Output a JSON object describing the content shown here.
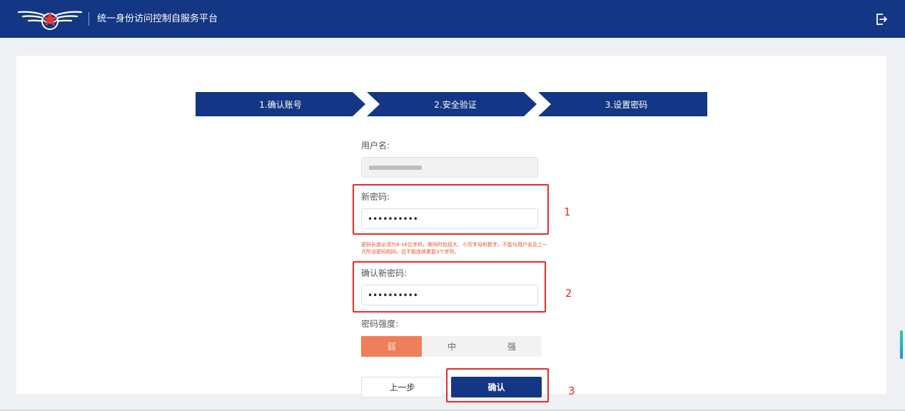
{
  "header": {
    "title": "统一身份访问控制自服务平台",
    "logo_icon": "wings-star-emblem-icon",
    "logout_icon": "logout-icon",
    "bg_color": "#133784"
  },
  "steps": [
    {
      "label": "1.确认账号"
    },
    {
      "label": "2.安全验证"
    },
    {
      "label": "3.设置密码"
    }
  ],
  "form": {
    "username_label": "用户名:",
    "username_value_note": "blurred",
    "new_password_label": "新密码:",
    "new_password_value": "••••••••••",
    "hint": "密码长度必须为8-16位字符，需同时包括大、小写字母和数字，不能与用户名及上一次所设密码相同。且不能连续重复3个字符。",
    "confirm_password_label": "确认新密码:",
    "confirm_password_value": "••••••••••",
    "strength_label": "密码强度:",
    "strength_levels": [
      "弱",
      "中",
      "强"
    ],
    "strength_active": "弱",
    "strength_active_color": "#ee7f5a"
  },
  "buttons": {
    "prev": "上一步",
    "confirm": "确认"
  },
  "annotations": [
    "1",
    "2",
    "3"
  ],
  "accent_color": "#e62b2b"
}
